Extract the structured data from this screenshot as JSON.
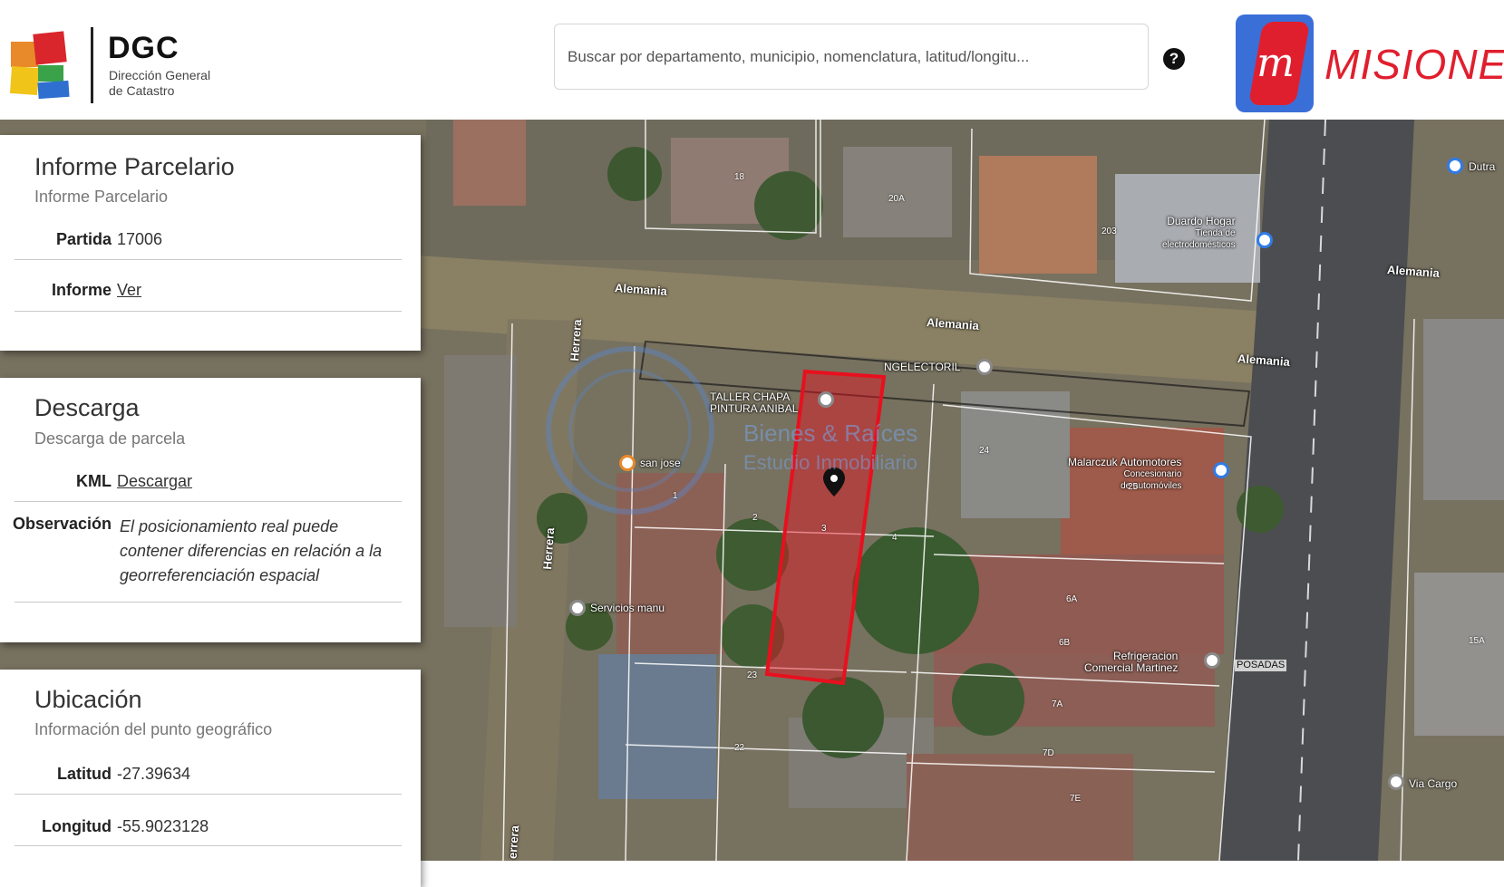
{
  "header": {
    "logo_title": "DGC",
    "logo_subtitle_line1": "Dirección General",
    "logo_subtitle_line2": "de Catastro",
    "search_placeholder": "Buscar por departamento, municipio, nomenclatura, latitud/longitu...",
    "help_label": "?",
    "province_logo_text": "MISIONES"
  },
  "panels": {
    "informe": {
      "title": "Informe Parcelario",
      "subtitle": "Informe Parcelario",
      "partida_label": "Partida",
      "partida_value": "17006",
      "informe_label": "Informe",
      "informe_link": "Ver"
    },
    "descarga": {
      "title": "Descarga",
      "subtitle": "Descarga de parcela",
      "kml_label": "KML",
      "kml_link": "Descargar",
      "obs_label": "Observación",
      "obs_value": "El posicionamiento real puede contener diferencias en relación a la georreferenciación espacial"
    },
    "ubicacion": {
      "title": "Ubicación",
      "subtitle": "Información del punto geográfico",
      "lat_label": "Latitud",
      "lat_value": "-27.39634",
      "lon_label": "Longitud",
      "lon_value": "-55.9023128"
    }
  },
  "map": {
    "streets": {
      "alemania_1": "Alemania",
      "alemania_2": "Alemania",
      "alemania_3": "Alemania",
      "alemania_4": "Alemania",
      "herrera_1": "Herrera",
      "herrera_2": "Herrera",
      "herrera_3": "errera"
    },
    "pois": {
      "duardo_hogar": "Duardo Hogar",
      "duardo_hogar_sub1": "Tienda de",
      "duardo_hogar_sub2": "electrodomésticos",
      "malarczuk": "Malarczuk Automotores",
      "malarczuk_sub1": "Concesionario",
      "malarczuk_sub2": "de automóviles",
      "taller_1": "TALLER CHAPA",
      "taller_2": "PINTURA ANIBAL",
      "ingelectoril": "NGELECTORIL",
      "san_jose": "san jose",
      "servicios_manu": "Servicios manu",
      "refrigeracion_1": "Refrigeracion",
      "refrigeracion_2": "Comercial Martinez",
      "posadas": "POSADAS",
      "via_cargo": "Via Cargo",
      "dutra": "Dutra"
    },
    "watermark_1": "Bienes & Raíces",
    "watermark_2": "Estudio Inmobiliario",
    "lots": [
      "18",
      "20A",
      "203",
      "24",
      "25",
      "2",
      "1",
      "3",
      "4",
      "6A",
      "6B",
      "7A",
      "7D",
      "23",
      "22",
      "15A",
      "7E"
    ],
    "colors": {
      "parcel_outline": "#e8101e",
      "parcel_fill": "#e8101e",
      "lot_lines": "#ffffff"
    }
  }
}
